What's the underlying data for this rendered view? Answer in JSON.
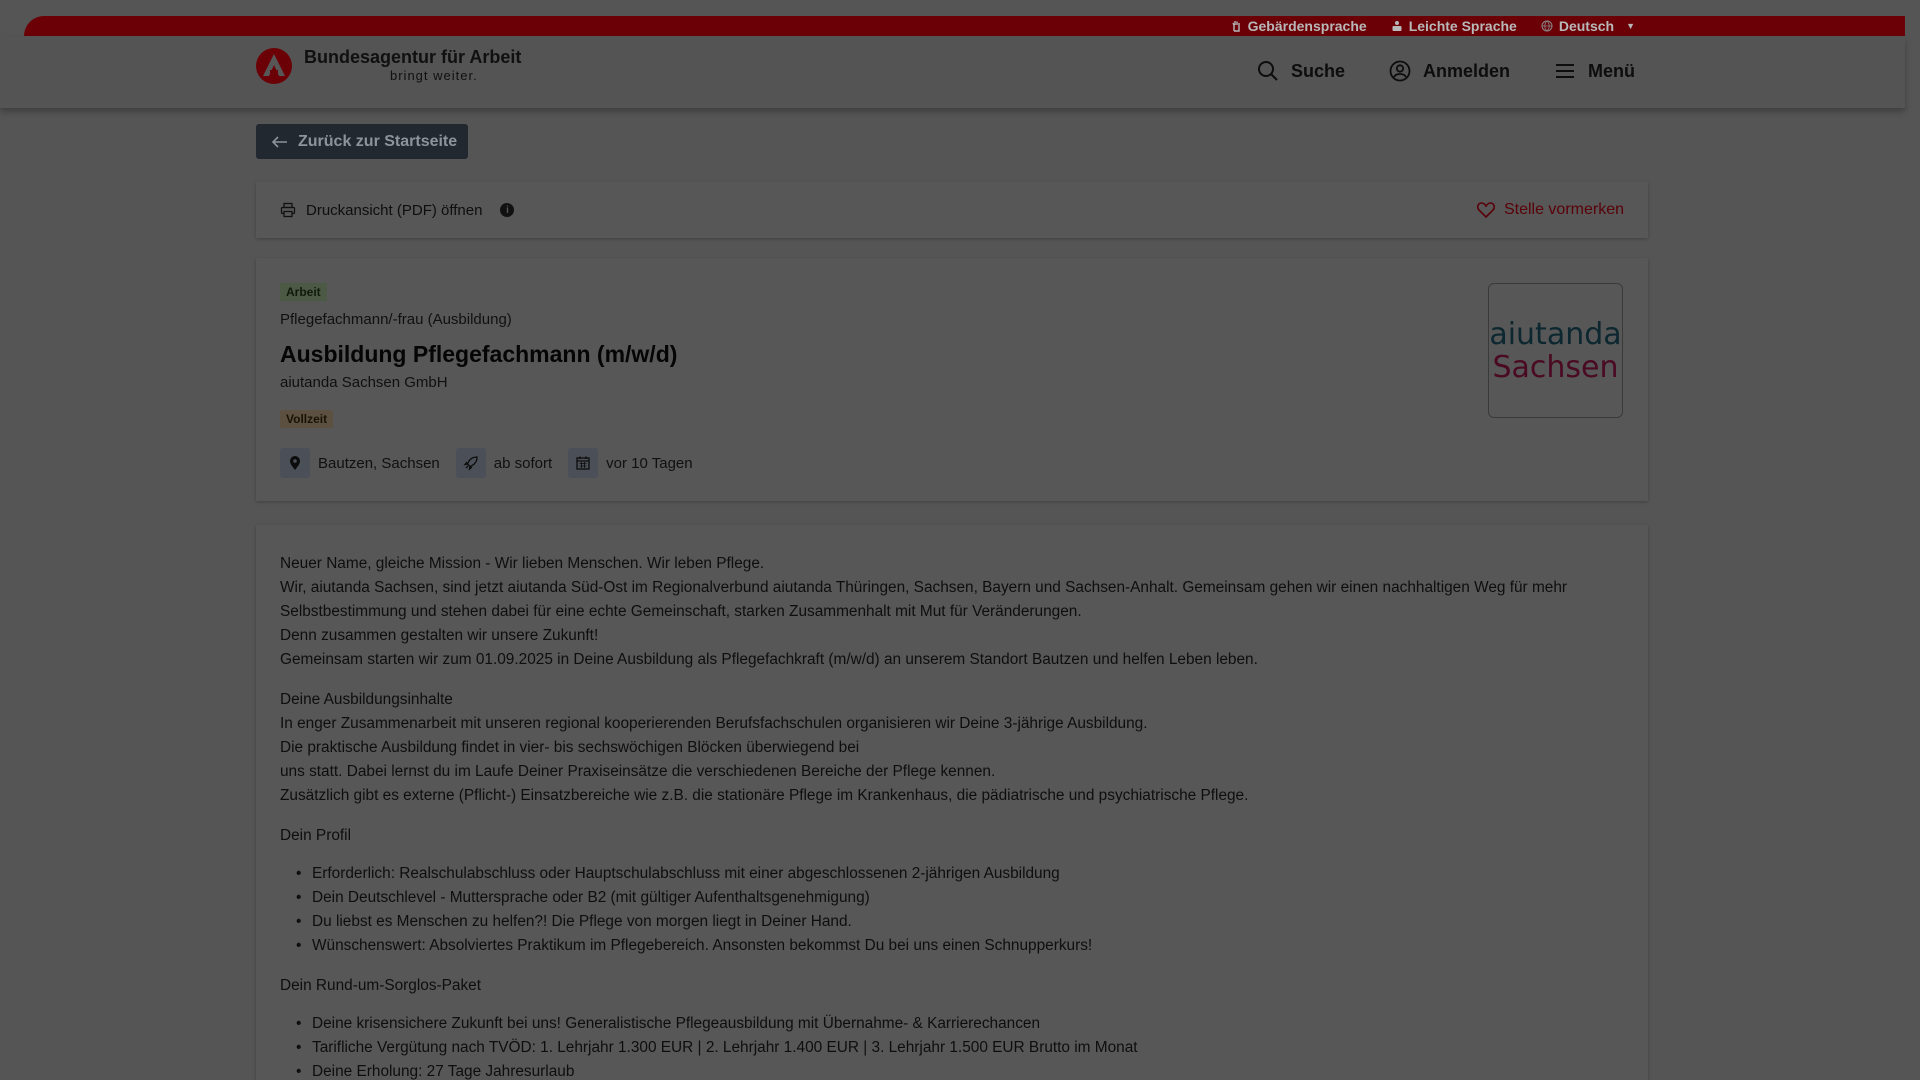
{
  "topbar": {
    "items": [
      "Gebärdensprache",
      "Leichte Sprache",
      "Deutsch"
    ]
  },
  "header": {
    "logo_title": "Bundesagentur für Arbeit",
    "logo_sub": "bringt weiter.",
    "nav": [
      "Suche",
      "Anmelden",
      "Menü"
    ]
  },
  "back_label": "Zurück zur Startseite",
  "printbar": {
    "print_label": "Druckansicht (PDF) öffnen",
    "info": "i",
    "bookmark_label": "Stelle vormerken"
  },
  "job": {
    "type_badge": "Arbeit",
    "category": "Pflegefachmann/-frau (Ausbildung)",
    "title": "Ausbildung Pflegefachmann (m/w/d)",
    "employer": "aiutanda Sachsen GmbH",
    "worktime_badge": "Vollzeit",
    "location": "Bautzen, Sachsen",
    "start": "ab sofort",
    "posted": "vor 10 Tagen",
    "logo_line1": "aiutanda",
    "logo_line2": "Sachsen"
  },
  "description": {
    "intro": [
      "Neuer Name, gleiche Mission - Wir lieben Menschen. Wir leben Pflege.",
      "Wir, aiutanda Sachsen, sind jetzt aiutanda Süd-Ost im Regionalverbund aiutanda Thüringen, Sachsen, Bayern und Sachsen-Anhalt. Gemeinsam gehen wir einen nachhaltigen Weg für mehr Selbstbestimmung und stehen dabei für eine echte Gemeinschaft, starken Zusammenhalt mit Mut für Veränderungen.",
      "Denn zusammen gestalten wir unsere Zukunft!",
      "Gemeinsam starten wir zum 01.09.2025 in Deine Ausbildung als Pflegefachkraft (m/w/d) an unserem Standort Bautzen und helfen Leben leben."
    ],
    "section1_title": "Deine Ausbildungsinhalte",
    "section1_lines": [
      "In enger Zusammenarbeit mit unseren regional kooperierenden Berufsfachschulen organisieren wir Deine 3-jährige Ausbildung.",
      "Die praktische Ausbildung findet in vier- bis sechswöchigen Blöcken überwiegend bei",
      "uns statt. Dabei lernst du im Laufe Deiner Praxiseinsätze die verschiedenen Bereiche der Pflege kennen.",
      "Zusätzlich gibt es externe (Pflicht-) Einsatzbereiche wie z.B. die stationäre Pflege im Krankenhaus, die pädiatrische und psychiatrische Pflege."
    ],
    "section2_title": "Dein Profil",
    "section2_items": [
      "Erforderlich: Realschulabschluss oder Hauptschulabschluss mit einer abgeschlossenen 2-jährigen Ausbildung",
      "Dein Deutschlevel - Muttersprache oder B2 (mit gültiger Aufenthaltsgenehmigung)",
      "Du liebst es Menschen zu helfen?! Die Pflege von morgen liegt in Deiner Hand.",
      "Wünschenswert: Absolviertes Praktikum im Pflegebereich. Ansonsten bekommst Du bei uns einen Schnupperkurs!"
    ],
    "section3_title": "Dein Rund-um-Sorglos-Paket",
    "section3_items": [
      "Deine krisensichere Zukunft bei uns! Generalistische Pflegeausbildung mit Übernahme- & Karrierechancen",
      "Tarifliche Vergütung nach TVÖD: 1. Lehrjahr 1.300 EUR | 2. Lehrjahr 1.400 EUR | 3. Lehrjahr 1.500 EUR Brutto im Monat",
      "Deine Erholung: 27 Tage Jahresurlaub"
    ]
  }
}
